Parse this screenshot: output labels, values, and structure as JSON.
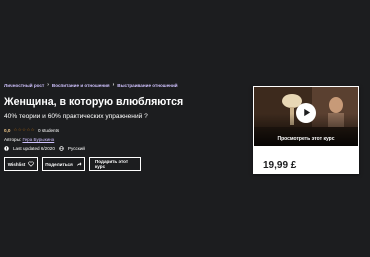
{
  "breadcrumb": {
    "items": [
      "Личностный рост",
      "Воспитание и отношения",
      "Выстраивание отношений"
    ]
  },
  "course": {
    "title": "Женщина, в которую влюбляются",
    "subtitle": "40% теории и 60% практических упражнений ?",
    "rating": "0,0",
    "students": "0 students",
    "authors_label": "Авторы:",
    "author_name": "Гера Бурыкина",
    "last_updated": "Last updated 6/2020",
    "language": "Русский"
  },
  "buttons": {
    "wishlist": "Wishlist",
    "share": "Поделиться",
    "gift": "Подарить этот курс"
  },
  "sidebar_card": {
    "preview_label": "Просмотреть этот курс",
    "price": "19,99 £"
  },
  "colors": {
    "background": "#1c1d1f",
    "link": "#cec0fc",
    "rating": "#f3ca8c"
  }
}
